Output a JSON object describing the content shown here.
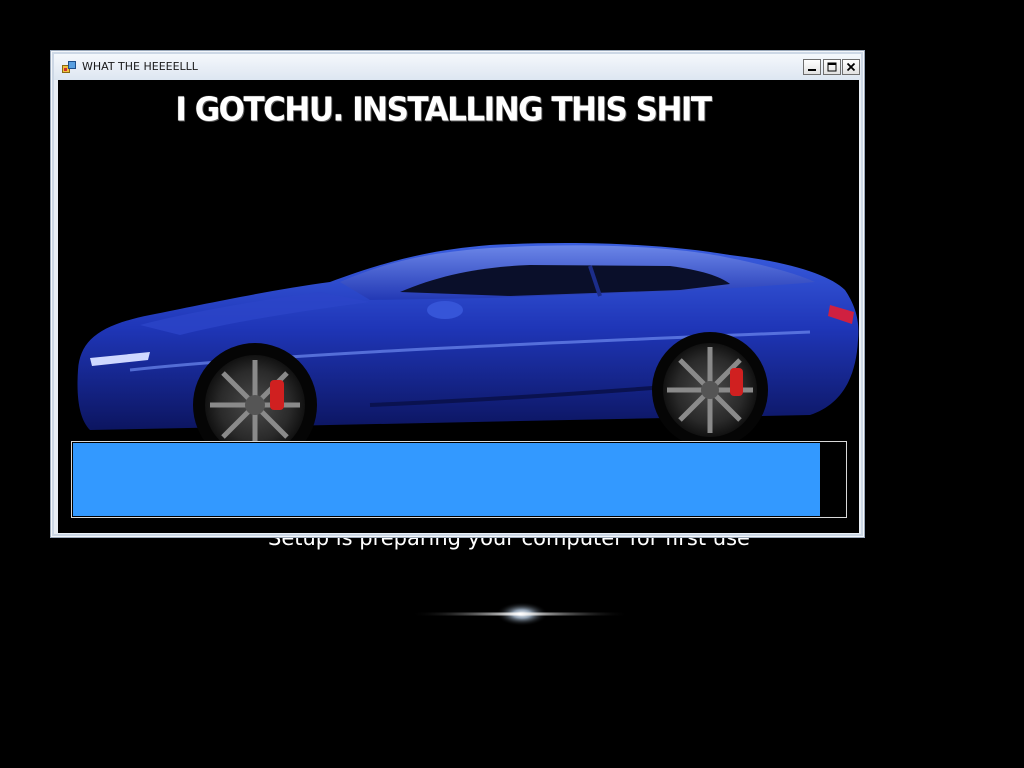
{
  "background": {
    "status_text": "Setup is preparing your computer for first use"
  },
  "window": {
    "title": "WHAT THE HEEEELLL",
    "heading": "I GOTCHU. INSTALLING THIS SHIT",
    "controls": {
      "minimize_icon": "minimize-icon",
      "maximize_icon": "maximize-icon",
      "close_icon": "close-icon"
    },
    "image": "blue-sports-car",
    "progress": {
      "fraction": 0.967,
      "fill_color": "#3399ff"
    }
  }
}
